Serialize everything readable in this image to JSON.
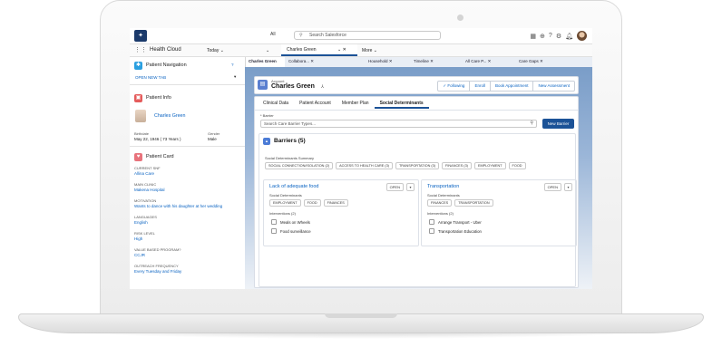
{
  "header": {
    "search_scope": "All",
    "search_placeholder": "Search Salesforce",
    "icons": [
      "grid-icon",
      "plus-icon",
      "help-icon",
      "gear-icon",
      "bell-icon"
    ]
  },
  "appnav": {
    "app_name": "Health Cloud",
    "items": [
      {
        "label": "Today ⌄"
      },
      {
        "label": "⌄"
      },
      {
        "label": "Charles Green"
      },
      {
        "label": "⌄ ✕"
      },
      {
        "label": "More ⌄"
      }
    ]
  },
  "subtabs": [
    {
      "label": "Charles Green"
    },
    {
      "label": "Collabora... ✕"
    },
    {
      "label": "Household ✕"
    },
    {
      "label": "Timeline ✕"
    },
    {
      "label": "All Care P... ✕"
    },
    {
      "label": "Care Gaps ✕"
    }
  ],
  "left": {
    "nav_title": "Patient Navigation",
    "nav_help": "?",
    "open_tab": "OPEN NEW TAB",
    "info_title": "Patient Info",
    "patient_name": "Charles Green",
    "birthdate_label": "Birthdate",
    "birthdate_value": "May 22, 1946 ( 73 Years )",
    "gender_label": "Gender",
    "gender_value": "Male",
    "card_title": "Patient Card",
    "fields": [
      {
        "label": "CURRENT SNF",
        "value": "Allina Care"
      },
      {
        "label": "MAIN CLINIC",
        "value": "Makena Hospital"
      },
      {
        "label": "MOTIVATION",
        "value": "Wants to dance with his daughter at her wedding"
      },
      {
        "label": "LANGUAGES",
        "value": "English"
      },
      {
        "label": "RISK LEVEL",
        "value": "High"
      },
      {
        "label": "VALUE BASED PROGRAM?",
        "value": "CCJR"
      },
      {
        "label": "OUTREACH FREQUENCY",
        "value": "Every Tuesday and Friday"
      }
    ]
  },
  "record": {
    "type": "Account",
    "name": "Charles Green",
    "buttons": [
      {
        "label": "✓ Following"
      },
      {
        "label": "Enroll"
      },
      {
        "label": "Book Appointment"
      },
      {
        "label": "New Assessment"
      }
    ]
  },
  "tabs": [
    {
      "label": "Clinical Data"
    },
    {
      "label": "Patient Account"
    },
    {
      "label": "Member Plan"
    },
    {
      "label": "Social Determinants"
    }
  ],
  "barrier": {
    "label": "* Barrier",
    "placeholder": "Search Care Barrier Types...",
    "new_button": "New Barrier",
    "section_title": "Barriers (5)",
    "summary_label": "Social Determinants Summary",
    "summary_pills": [
      "SOCIAL CONNECTION/ISOLATION (2)",
      "ACCESS TO HEALTH CARE (3)",
      "TRANSPORTATION (3)",
      "FINANCES (3)",
      "EMPLOYMENT",
      "FOOD"
    ]
  },
  "cards": [
    {
      "title": "Lack of adequate food",
      "status": "OPEN",
      "sd_label": "Social Determinants",
      "pills": [
        "EMPLOYMENT",
        "FOOD",
        "FINANCES"
      ],
      "int_label": "Interventions (2)",
      "interventions": [
        "Meals on Wheels",
        "Food surveillance"
      ]
    },
    {
      "title": "Transportation",
      "status": "OPEN",
      "sd_label": "Social Determinants",
      "pills": [
        "FINANCES",
        "TRANSPORTATION"
      ],
      "int_label": "Interventions (2)",
      "interventions": [
        "Arrange Transport - Uber",
        "Transportation Education"
      ]
    }
  ],
  "colors": {
    "brand": "#1b5297",
    "link": "#0a63c2",
    "header_bg": "#7a9dc8"
  }
}
